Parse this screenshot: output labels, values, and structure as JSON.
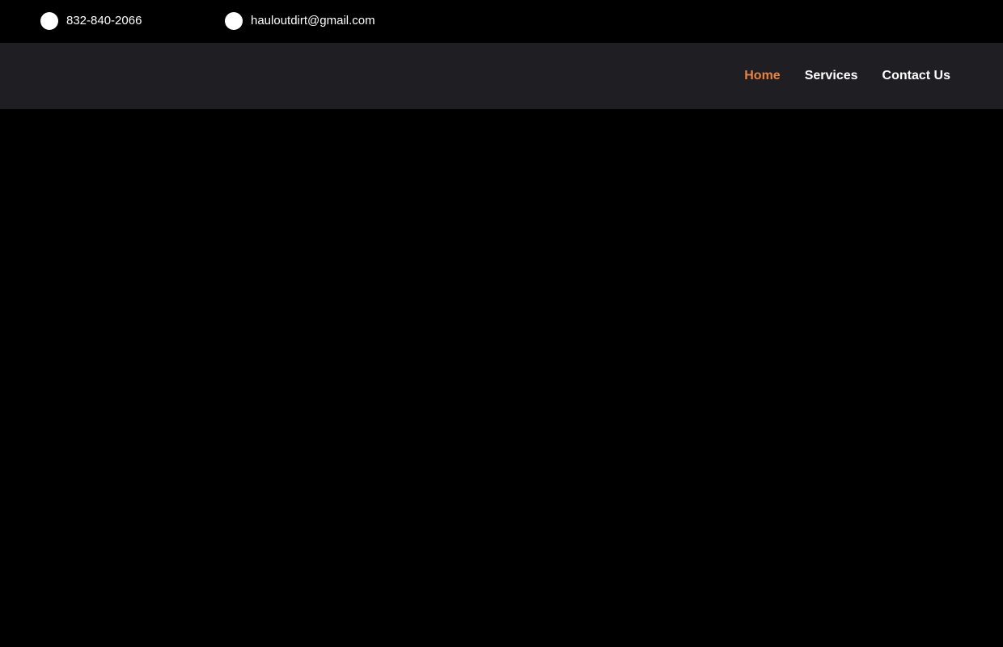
{
  "topbar": {
    "phone": {
      "text": "832-840-2066",
      "icon": "phone-icon"
    },
    "email": {
      "text": "hauloutdirt@gmail.com",
      "icon": "email-icon"
    }
  },
  "nav": {
    "items": [
      {
        "label": "Home",
        "active": true
      },
      {
        "label": "Services",
        "active": false
      },
      {
        "label": "Contact Us",
        "active": false
      }
    ]
  },
  "colors": {
    "topbar_bg": "#000000",
    "navbar_bg": "#1f1e23",
    "active_link": "#e8823f",
    "text": "#ffffff"
  }
}
